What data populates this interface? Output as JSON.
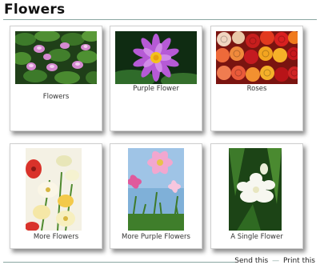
{
  "page": {
    "title": "Flowers"
  },
  "gallery": {
    "items": [
      {
        "caption": "Flowers"
      },
      {
        "caption": "Purple Flower"
      },
      {
        "caption": "Roses"
      },
      {
        "caption": "More Flowers"
      },
      {
        "caption": "More Purple Flowers"
      },
      {
        "caption": "A Single Flower"
      }
    ]
  },
  "footer": {
    "send_label": "Send this",
    "print_label": "Print this",
    "separator": "—"
  }
}
